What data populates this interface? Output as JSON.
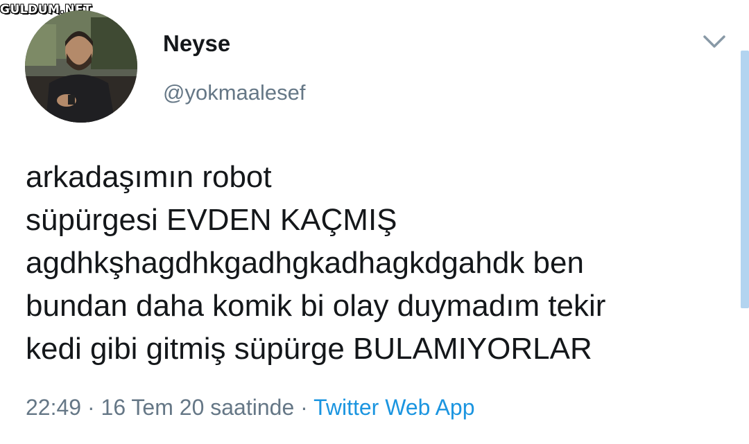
{
  "watermark": "GULDUM.NET",
  "user": {
    "display_name": "Neyse",
    "handle": "@yokmaalesef"
  },
  "tweet": {
    "text": "arkadaşımın robot\nsüpürgesi EVDEN KAÇMIŞ\nagdhkşhagdhkgadhgkadhagkdgahdk ben\nbundan daha komik bi olay duymadım tekir\nkedi gibi gitmiş süpürge BULAMIYORLAR",
    "time": "22:49",
    "separator": " · ",
    "date": "16 Tem 20 saatinde",
    "source": "Twitter Web App"
  },
  "icons": {
    "menu": "chevron-down-icon",
    "avatar": "profile-photo"
  },
  "colors": {
    "text": "#14171a",
    "secondary": "#657786",
    "link": "#1b95e0"
  }
}
